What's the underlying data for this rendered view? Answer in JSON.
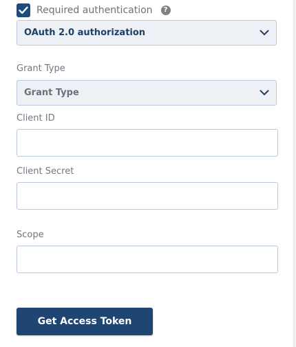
{
  "auth": {
    "checkbox_checked": true,
    "label": "Required authentication",
    "help_glyph": "?",
    "help_icon": "question-circle-icon"
  },
  "auth_type": {
    "selected": "OAuth 2.0 authorization",
    "icon": "chevron-down-icon"
  },
  "grant_type": {
    "label": "Grant Type",
    "selected": "Grant Type",
    "icon": "chevron-down-icon"
  },
  "client_id": {
    "label": "Client ID",
    "value": ""
  },
  "client_secret": {
    "label": "Client Secret",
    "value": ""
  },
  "scope": {
    "label": "Scope",
    "value": ""
  },
  "actions": {
    "get_token_label": "Get Access Token"
  },
  "colors": {
    "accent": "#1f4573",
    "field_border": "#b9c8de",
    "select_bg": "#edf0f5"
  }
}
